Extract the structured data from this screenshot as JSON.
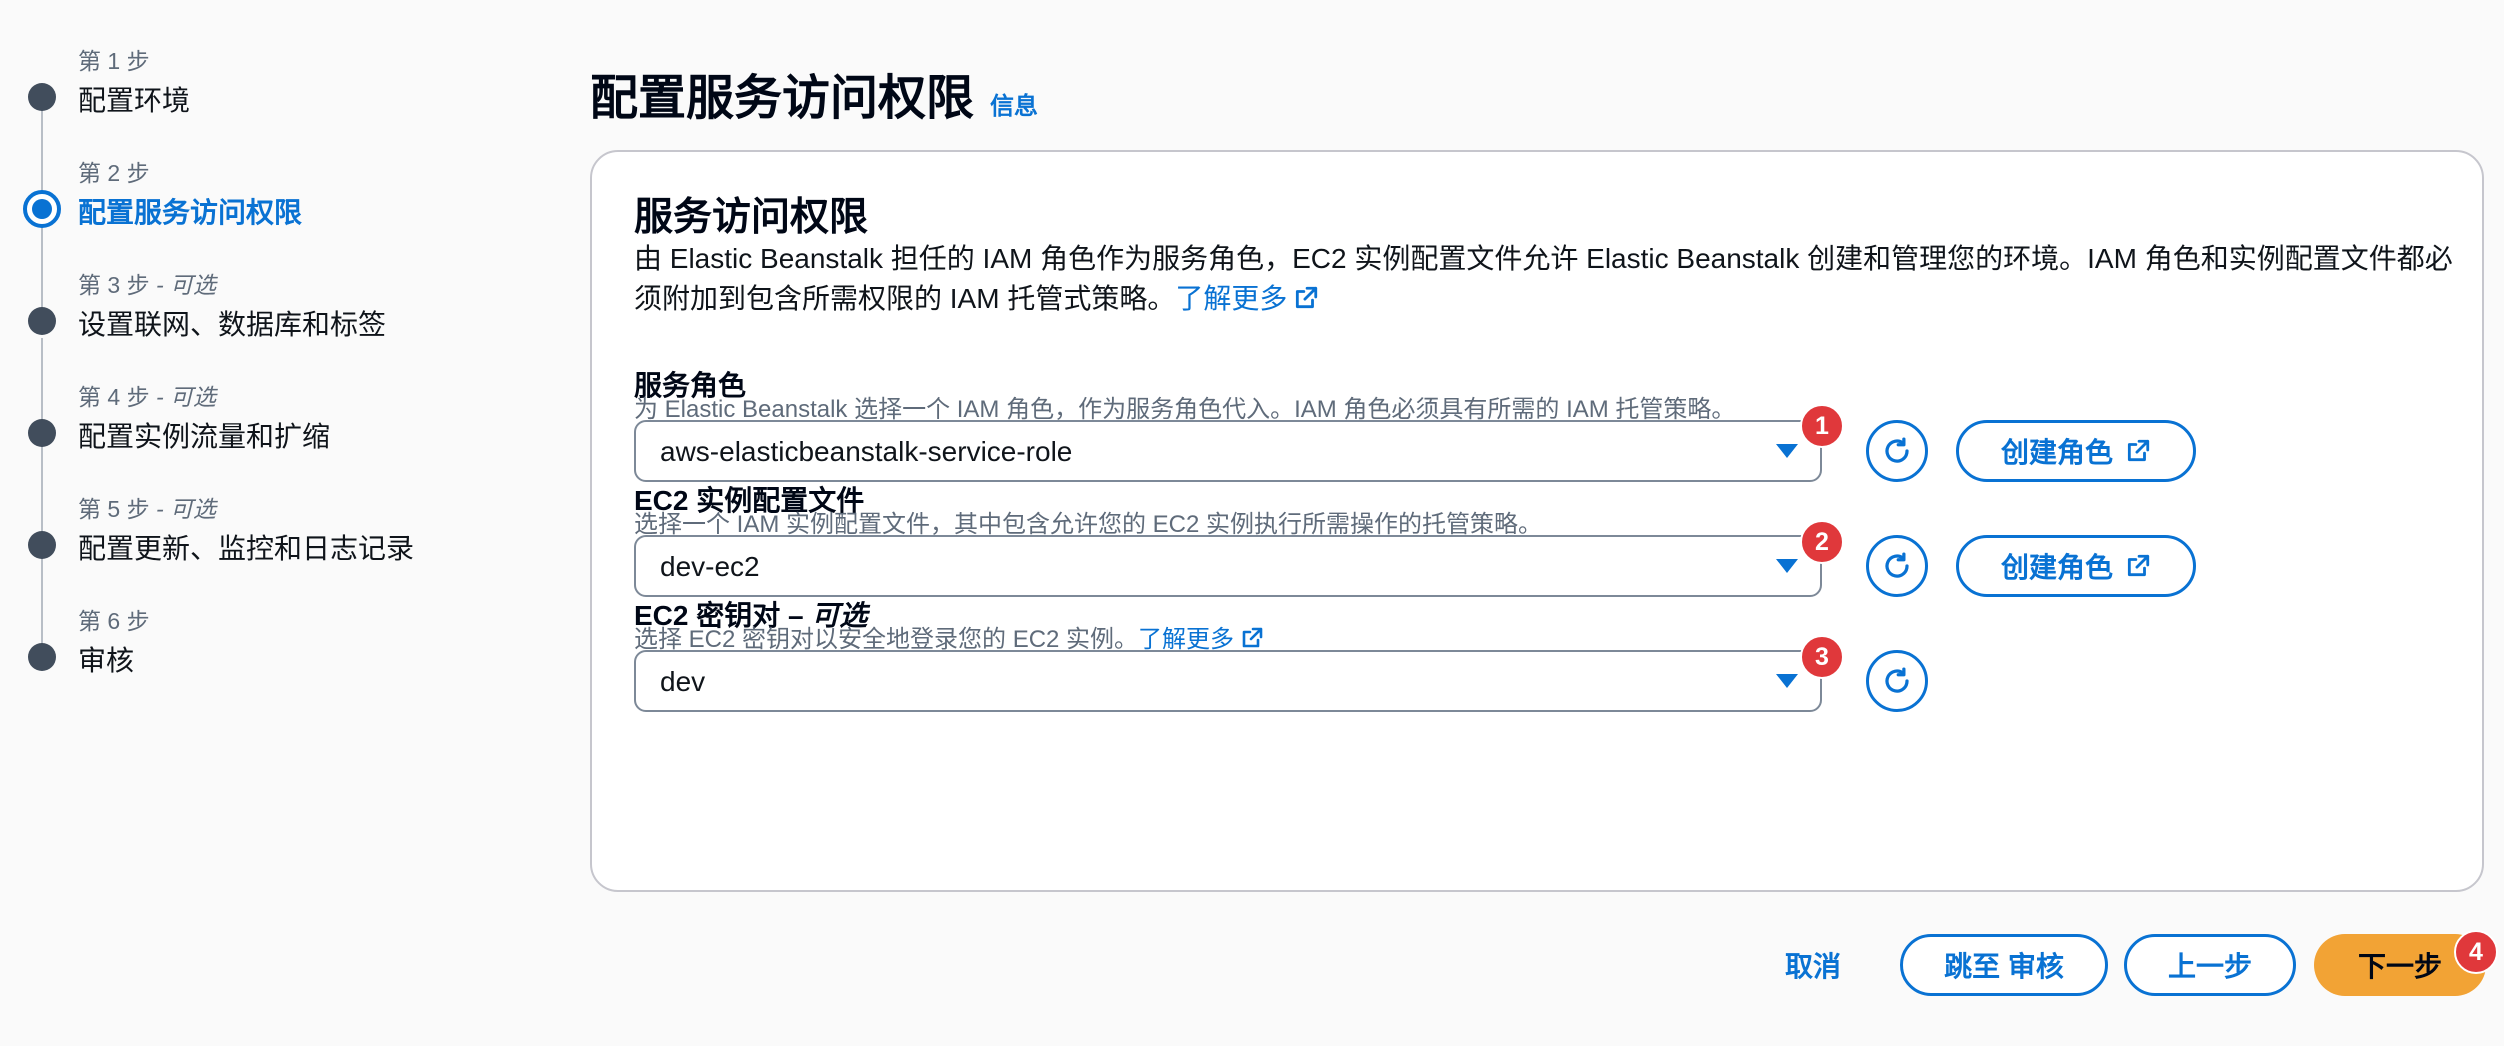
{
  "wizard": {
    "steps": [
      {
        "number": "第 1 步",
        "optional": "",
        "label": "配置环境",
        "active": false
      },
      {
        "number": "第 2 步",
        "optional": "",
        "label": "配置服务访问权限",
        "active": true
      },
      {
        "number": "第 3 步",
        "optional": " - 可选",
        "label": "设置联网、数据库和标签",
        "active": false
      },
      {
        "number": "第 4 步",
        "optional": " - 可选",
        "label": "配置实例流量和扩缩",
        "active": false
      },
      {
        "number": "第 5 步",
        "optional": " - 可选",
        "label": "配置更新、监控和日志记录",
        "active": false
      },
      {
        "number": "第 6 步",
        "optional": "",
        "label": "审核",
        "active": false
      }
    ]
  },
  "header": {
    "title": "配置服务访问权限",
    "info_label": "信息"
  },
  "service_access": {
    "title": "服务访问权限",
    "description": "由 Elastic Beanstalk 担任的 IAM 角色作为服务角色，EC2 实例配置文件允许 Elastic Beanstalk 创建和管理您的环境。IAM 角色和实例配置文件都必须附加到包含所需权限的 IAM 托管式策略。",
    "learn_more": "了解更多"
  },
  "service_role": {
    "label": "服务角色",
    "description": "为 Elastic Beanstalk 选择一个 IAM 角色，作为服务角色代入。IAM 角色必须具有所需的 IAM 托管策略。",
    "value": "aws-elasticbeanstalk-service-role",
    "badge": "1",
    "create_label": "创建角色"
  },
  "ec2_profile": {
    "label": "EC2 实例配置文件",
    "description": "选择一个 IAM 实例配置文件，其中包含允许您的 EC2 实例执行所需操作的托管策略。",
    "value": "dev-ec2",
    "badge": "2",
    "create_label": "创建角色"
  },
  "ec2_keypair": {
    "label": "EC2 密钥对 – ",
    "label_optional": "可选",
    "description": "选择 EC2 密钥对以安全地登录您的 EC2 实例。",
    "learn_more": "了解更多",
    "value": "dev",
    "badge": "3"
  },
  "footer": {
    "cancel": "取消",
    "skip_to_review": "跳至 审核",
    "previous": "上一步",
    "next": "下一步",
    "next_badge": "4"
  },
  "colors": {
    "accent": "#0972d3",
    "primary_button": "#f2a335",
    "badge": "#e0383b",
    "active_step": "#0972d3",
    "inactive_step_dot": "#414d5c"
  },
  "icons": [
    "external-link-icon",
    "refresh-icon",
    "caret-down-icon",
    "step-dot-icon"
  ]
}
